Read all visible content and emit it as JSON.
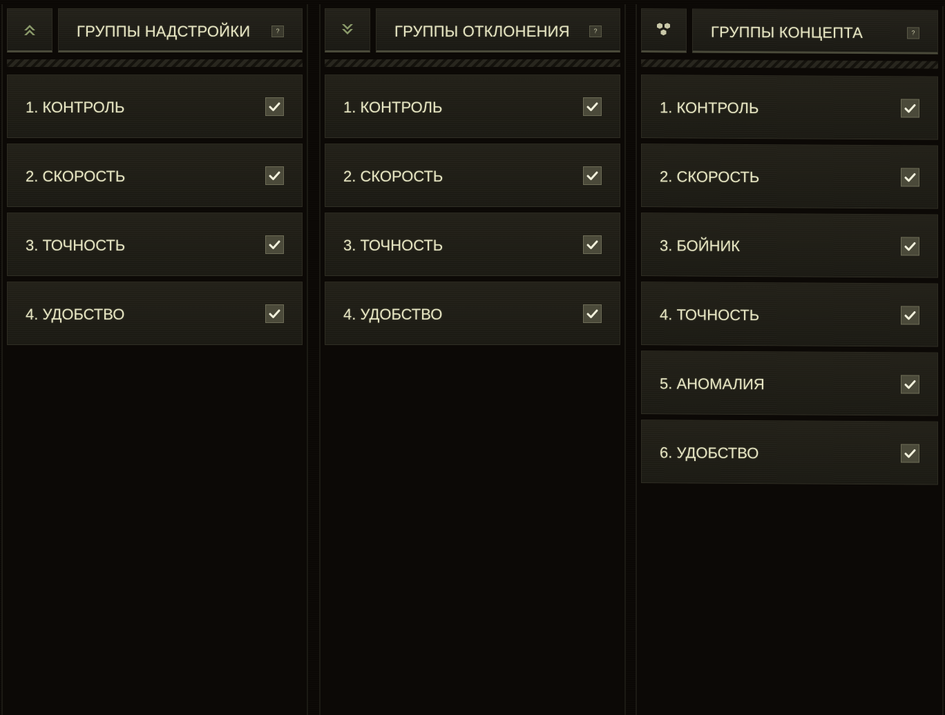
{
  "colors": {
    "text": "#e7e6c3",
    "panel": "#1e1d16",
    "checkbox": "#4b4a3a",
    "background": "#0b0805"
  },
  "columns": [
    {
      "icon": "double-chevron-up-icon",
      "title": "ГРУППЫ НАДСТРОЙКИ",
      "help": "?",
      "items": [
        {
          "label": "1. КОНТРОЛЬ",
          "checked": true
        },
        {
          "label": "2. СКОРОСТЬ",
          "checked": true
        },
        {
          "label": "3. ТОЧНОСТЬ",
          "checked": true
        },
        {
          "label": "4. УДОБСТВО",
          "checked": true
        }
      ]
    },
    {
      "icon": "double-chevron-down-icon",
      "title": "ГРУППЫ ОТКЛОНЕНИЯ",
      "help": "?",
      "items": [
        {
          "label": "1. КОНТРОЛЬ",
          "checked": true
        },
        {
          "label": "2. СКОРОСТЬ",
          "checked": true
        },
        {
          "label": "3. ТОЧНОСТЬ",
          "checked": true
        },
        {
          "label": "4. УДОБСТВО",
          "checked": true
        }
      ]
    },
    {
      "icon": "hexagon-cluster-icon",
      "title": "ГРУППЫ КОНЦЕПТА",
      "help": "?",
      "items": [
        {
          "label": "1. КОНТРОЛЬ",
          "checked": true
        },
        {
          "label": "2. СКОРОСТЬ",
          "checked": true
        },
        {
          "label": "3. БОЙНИК",
          "checked": true
        },
        {
          "label": "4. ТОЧНОСТЬ",
          "checked": true
        },
        {
          "label": "5. АНОМАЛИЯ",
          "checked": true
        },
        {
          "label": "6. УДОБСТВО",
          "checked": true
        }
      ]
    }
  ]
}
